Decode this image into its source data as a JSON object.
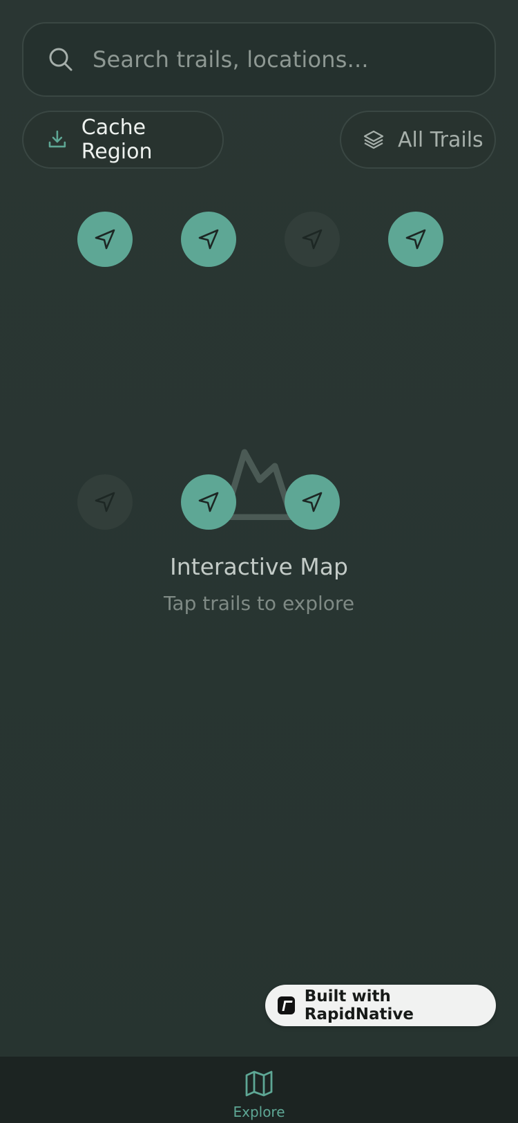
{
  "search": {
    "placeholder": "Search trails, locations..."
  },
  "actions": {
    "cache_label": "Cache Region",
    "filter_label": "All Trails"
  },
  "markers": [
    {
      "active": true
    },
    {
      "active": true
    },
    {
      "active": false
    },
    {
      "active": true
    },
    {
      "active": false
    },
    {
      "active": true
    },
    {
      "active": true
    }
  ],
  "map": {
    "title": "Interactive Map",
    "subtitle": "Tap trails to explore"
  },
  "badge": {
    "label": "Built with RapidNative"
  },
  "tabbar": {
    "tabs": [
      {
        "label": "Explore",
        "icon": "map-icon",
        "active": true
      }
    ]
  },
  "colors": {
    "accent": "#5ea795",
    "background": "#2a3632",
    "tabbar": "#1c2422"
  }
}
